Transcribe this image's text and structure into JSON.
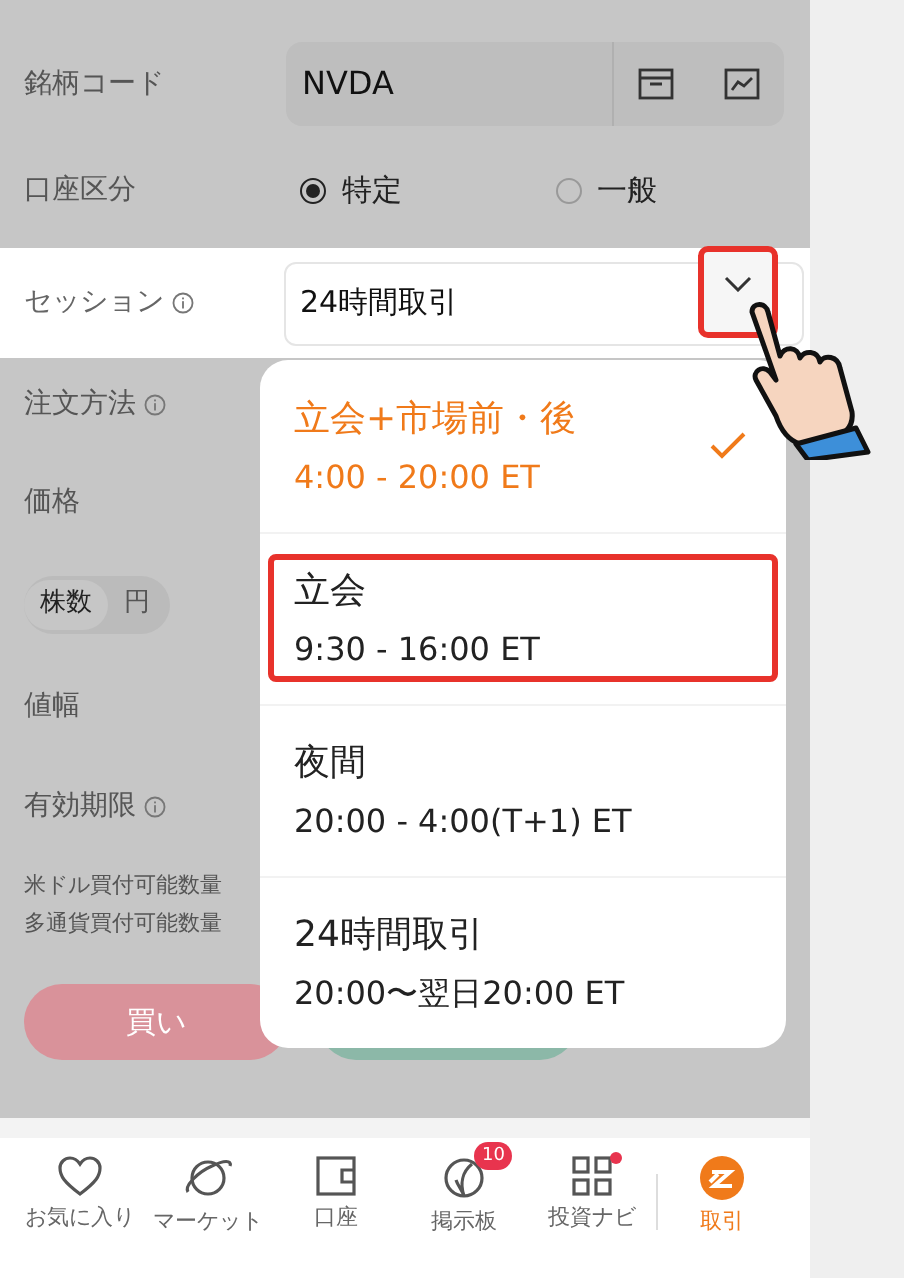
{
  "form": {
    "symbol": {
      "label": "銘柄コード",
      "value": "NVDA"
    },
    "account": {
      "label": "口座区分",
      "options": [
        {
          "label": "特定",
          "selected": true
        },
        {
          "label": "一般",
          "selected": false
        }
      ]
    },
    "session": {
      "label": "セッション",
      "value": "24時間取引"
    },
    "order_method": {
      "label": "注文方法"
    },
    "price": {
      "label": "価格"
    },
    "unit_toggle": [
      {
        "label": "株数",
        "selected": true
      },
      {
        "label": "円",
        "selected": false
      }
    ],
    "price_range": {
      "label": "値幅"
    },
    "expiry": {
      "label": "有効期限"
    },
    "buying_power": [
      "米ドル買付可能数量",
      "多通貨買付可能数量"
    ],
    "buy_button": "買い"
  },
  "dropdown": {
    "options": [
      {
        "name": "立会+市場前・後",
        "hours": "4:00 - 20:00 ET",
        "selected": true,
        "highlighted": false
      },
      {
        "name": "立会",
        "hours": "9:30 - 16:00 ET",
        "selected": false,
        "highlighted": true
      },
      {
        "name": "夜間",
        "hours": "20:00 - 4:00(T+1) ET",
        "selected": false,
        "highlighted": false
      },
      {
        "name": "24時間取引",
        "hours": "20:00〜翌日20:00 ET",
        "selected": false,
        "highlighted": false
      }
    ]
  },
  "nav": [
    {
      "kind": "heart",
      "label": "お気に入り",
      "selected": false
    },
    {
      "kind": "planet",
      "label": "マーケット",
      "selected": false
    },
    {
      "kind": "wallet",
      "label": "口座",
      "selected": false
    },
    {
      "kind": "board",
      "label": "掲示板",
      "badge": "10",
      "selected": false
    },
    {
      "kind": "grid",
      "label": "投資ナビ",
      "dot": true,
      "selected": false
    },
    {
      "kind": "trade",
      "label": "取引",
      "selected": true
    }
  ]
}
